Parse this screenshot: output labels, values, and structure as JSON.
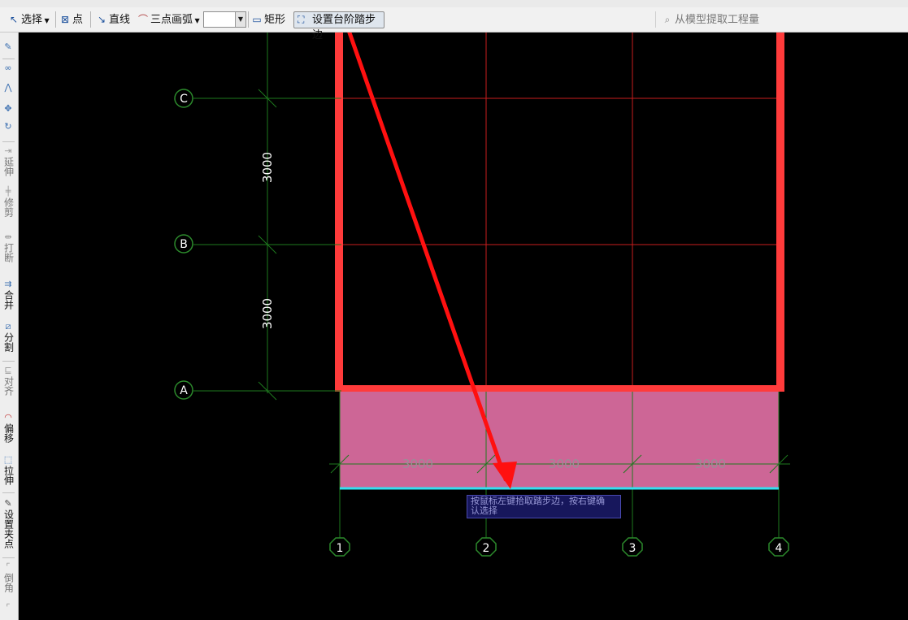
{
  "toolbar": {
    "select_label": "选择",
    "point_label": "点",
    "line_label": "直线",
    "arc_mode_label": "三点画弧",
    "rect_label": "矩形",
    "set_step_edge_label": "设置台阶踏步边",
    "extract_label": "从模型提取工程量"
  },
  "sidebar": {
    "extend": "延伸",
    "trim": "修剪",
    "break": "打断",
    "merge": "合并",
    "split": "分割",
    "align": "对齐",
    "offset": "偏移",
    "stretch": "拉伸",
    "set_grip": "设置夹点",
    "chamfer": "倒角"
  },
  "drawing": {
    "axes_rows": [
      "C",
      "B",
      "A"
    ],
    "axes_cols": [
      "1",
      "2",
      "3",
      "4"
    ],
    "dim_vertical": [
      "3000",
      "3000"
    ],
    "dim_horizontal": [
      "3000",
      "3000",
      "3000"
    ],
    "colors": {
      "background": "#000000",
      "axis_line": "#1e7a1e",
      "grid_line": "#c81e1e",
      "wall": "#ff3b3b",
      "step_fill": "#cd6696",
      "step_edge": "#33e0f0",
      "annotation_arrow": "#ff1010"
    }
  },
  "tooltip": {
    "line1": "按鼠标左键拾取踏步边，按右键确",
    "line2": "认选择"
  }
}
